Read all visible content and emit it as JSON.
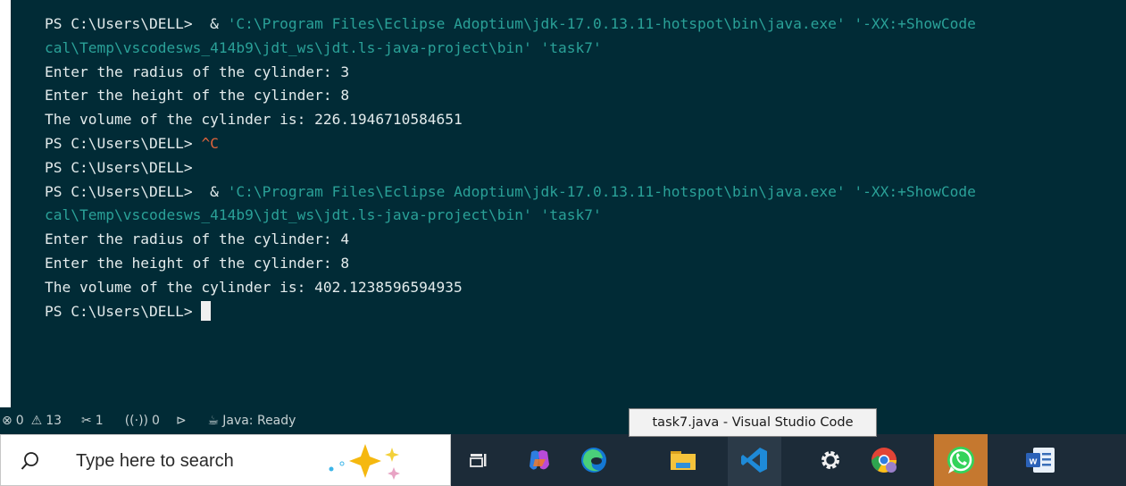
{
  "terminal": {
    "lines": [
      {
        "prompt": "PS C:\\Users\\DELL> ",
        "cmd": " & ",
        "str": "'C:\\Program Files\\Eclipse Adoptium\\jdk-17.0.13.11-hotspot\\bin\\java.exe' '-XX:+ShowCode"
      },
      {
        "str": "cal\\Temp\\vscodesws_414b9\\jdt_ws\\jdt.ls-java-project\\bin' 'task7'"
      },
      {
        "text": "Enter the radius of the cylinder: 3"
      },
      {
        "text": "Enter the height of the cylinder: 8"
      },
      {
        "text": "The volume of the cylinder is: 226.1946710584651"
      },
      {
        "prompt": "PS C:\\Users\\DELL> ",
        "ctrl": "^C"
      },
      {
        "prompt": "PS C:\\Users\\DELL>"
      },
      {
        "prompt": "PS C:\\Users\\DELL> ",
        "cmd": " & ",
        "str": "'C:\\Program Files\\Eclipse Adoptium\\jdk-17.0.13.11-hotspot\\bin\\java.exe' '-XX:+ShowCode"
      },
      {
        "str": "cal\\Temp\\vscodesws_414b9\\jdt_ws\\jdt.ls-java-project\\bin' 'task7'"
      },
      {
        "text": "Enter the radius of the cylinder: 4"
      },
      {
        "text": "Enter the height of the cylinder: 8"
      },
      {
        "text": "The volume of the cylinder is: 402.1238596594935"
      },
      {
        "prompt": "PS C:\\Users\\DELL> ",
        "cursor": true
      }
    ]
  },
  "statusbar": {
    "errors": "0",
    "warnings": "13",
    "tools": "1",
    "ports": "0",
    "java_status": "Java: Ready"
  },
  "tooltip": {
    "text": "task7.java - Visual Studio Code"
  },
  "taskbar": {
    "search_placeholder": "Type here to search",
    "apps": [
      "task-view",
      "copilot",
      "edge",
      "file-explorer",
      "vscode",
      "settings",
      "chrome",
      "whatsapp",
      "word"
    ]
  },
  "colors": {
    "terminal_bg": "#012b36",
    "string": "#2aa198",
    "ctrl": "#e0643c",
    "taskbar_bg": "#1c2b38",
    "active_app": "#c5782f"
  }
}
